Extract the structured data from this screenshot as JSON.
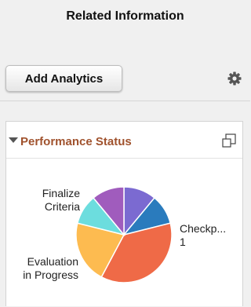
{
  "header": {
    "title": "Related Information",
    "add_button": "Add Analytics",
    "settings_icon": "gear-icon"
  },
  "panel": {
    "title": "Performance Status",
    "collapse_icon": "triangle-down-icon",
    "maximize_icon": "maximize-icon"
  },
  "chart_data": {
    "type": "pie",
    "slices": [
      {
        "label": "Checkp...\n1",
        "value": 40,
        "color": "#ef6a47"
      },
      {
        "label": "Evaluation\nin Progress",
        "value": 23,
        "color": "#fdbb50"
      },
      {
        "label": "",
        "value": 11,
        "color": "#6cddde"
      },
      {
        "label": "Finalize\nCriteria",
        "value": 12,
        "color": "#a05cbd"
      },
      {
        "label": "",
        "value": 12,
        "color": "#7b6ad1"
      },
      {
        "label": "",
        "value": 11,
        "color": "#2a7bbd"
      }
    ],
    "start_order": [
      4,
      5,
      0,
      1,
      2,
      3
    ],
    "labels": {
      "finalize": [
        "Finalize",
        "Criteria"
      ],
      "checkpoint": [
        "Checkp...",
        "1"
      ],
      "evaluation": [
        "Evaluation",
        "in Progress"
      ]
    }
  }
}
